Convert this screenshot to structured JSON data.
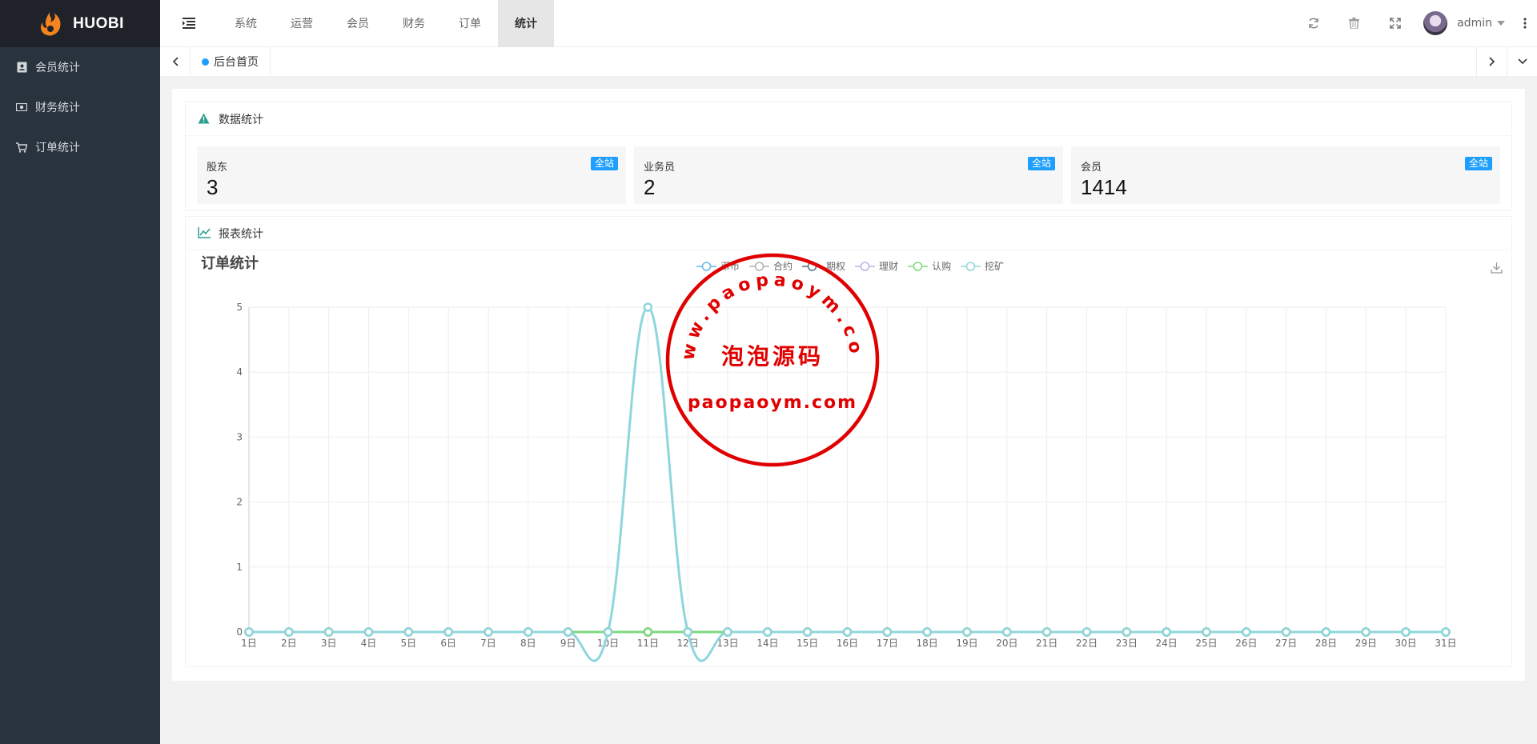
{
  "app": {
    "logo_text": "HUOBI"
  },
  "sidebar": {
    "items": [
      {
        "label": "会员统计",
        "icon": "contact-book-icon"
      },
      {
        "label": "财务统计",
        "icon": "money-icon"
      },
      {
        "label": "订单统计",
        "icon": "cart-icon"
      }
    ]
  },
  "header": {
    "nav": [
      {
        "label": "系统",
        "active": false
      },
      {
        "label": "运营",
        "active": false
      },
      {
        "label": "会员",
        "active": false
      },
      {
        "label": "财务",
        "active": false
      },
      {
        "label": "订单",
        "active": false
      },
      {
        "label": "统计",
        "active": true
      }
    ],
    "user_name": "admin",
    "icons": [
      "refresh-icon",
      "trash-icon",
      "fullscreen-icon",
      "more-vertical-icon"
    ]
  },
  "tabs": {
    "items": [
      {
        "label": "后台首页"
      }
    ]
  },
  "data_panel": {
    "title": "数据统计",
    "cards": [
      {
        "label": "股东",
        "value": "3",
        "badge": "全站"
      },
      {
        "label": "业务员",
        "value": "2",
        "badge": "全站"
      },
      {
        "label": "会员",
        "value": "1414",
        "badge": "全站"
      }
    ]
  },
  "report_panel": {
    "title": "报表统计"
  },
  "chart_data": {
    "type": "line",
    "title": "订单统计",
    "categories": [
      "1日",
      "2日",
      "3日",
      "4日",
      "5日",
      "6日",
      "7日",
      "8日",
      "9日",
      "10日",
      "11日",
      "12日",
      "13日",
      "14日",
      "15日",
      "16日",
      "17日",
      "18日",
      "19日",
      "20日",
      "21日",
      "22日",
      "23日",
      "24日",
      "25日",
      "26日",
      "27日",
      "28日",
      "29日",
      "30日",
      "31日"
    ],
    "ylim": [
      0,
      5
    ],
    "yticks": [
      0,
      1,
      2,
      3,
      4,
      5
    ],
    "grid": true,
    "smooth": true,
    "legend_position": "top-center",
    "series": [
      {
        "name": "币币",
        "color": "#69b7e8",
        "values": [
          0,
          0,
          0,
          0,
          0,
          0,
          0,
          0,
          0,
          0,
          0,
          0,
          0,
          0,
          0,
          0,
          0,
          0,
          0,
          0,
          0,
          0,
          0,
          0,
          0,
          0,
          0,
          0,
          0,
          0,
          0
        ]
      },
      {
        "name": "合约",
        "color": "#b0b0b0",
        "values": [
          0,
          0,
          0,
          0,
          0,
          0,
          0,
          0,
          0,
          0,
          0,
          0,
          0,
          0,
          0,
          0,
          0,
          0,
          0,
          0,
          0,
          0,
          0,
          0,
          0,
          0,
          0,
          0,
          0,
          0,
          0
        ]
      },
      {
        "name": "期权",
        "color": "#5b6a82",
        "values": [
          0,
          0,
          0,
          0,
          0,
          0,
          0,
          0,
          0,
          0,
          0,
          0,
          0,
          0,
          0,
          0,
          0,
          0,
          0,
          0,
          0,
          0,
          0,
          0,
          0,
          0,
          0,
          0,
          0,
          0,
          0
        ]
      },
      {
        "name": "理财",
        "color": "#b4b6e8",
        "values": [
          0,
          0,
          0,
          0,
          0,
          0,
          0,
          0,
          0,
          0,
          0,
          0,
          0,
          0,
          0,
          0,
          0,
          0,
          0,
          0,
          0,
          0,
          0,
          0,
          0,
          0,
          0,
          0,
          0,
          0,
          0
        ]
      },
      {
        "name": "认购",
        "color": "#7fd97f",
        "values": [
          0,
          0,
          0,
          0,
          0,
          0,
          0,
          0,
          0,
          0,
          0,
          0,
          0,
          0,
          0,
          0,
          0,
          0,
          0,
          0,
          0,
          0,
          0,
          0,
          0,
          0,
          0,
          0,
          0,
          0,
          0
        ]
      },
      {
        "name": "挖矿",
        "color": "#8fd6dc",
        "values": [
          0,
          0,
          0,
          0,
          0,
          0,
          0,
          0,
          0,
          0,
          5,
          0,
          0,
          0,
          0,
          0,
          0,
          0,
          0,
          0,
          0,
          0,
          0,
          0,
          0,
          0,
          0,
          0,
          0,
          0,
          0
        ]
      }
    ]
  },
  "watermark": {
    "top_arc_text": "www.paopaoym.com",
    "center_text": "泡泡源码",
    "bottom_text": "paopaoym.com",
    "color": "#e00000"
  },
  "colors": {
    "sidebar_bg": "#28333e",
    "logo_bg": "#20222a",
    "accent": "#1e9fff"
  }
}
